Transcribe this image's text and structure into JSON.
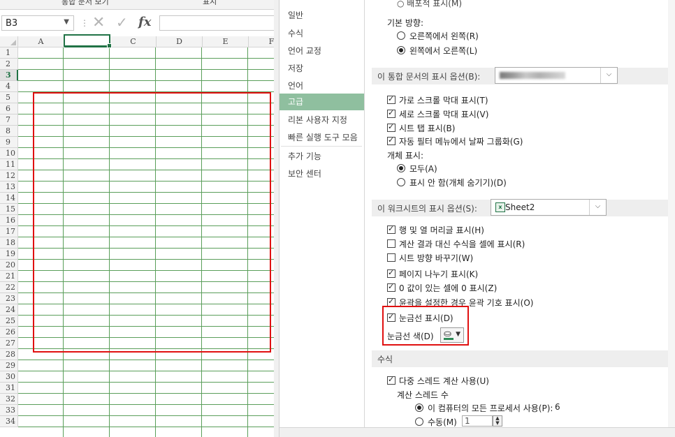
{
  "excel": {
    "ribbon_labels": [
      "통합 문서 보기",
      "표시"
    ],
    "name_box": "B3",
    "col_headers": [
      "A",
      "B",
      "C",
      "D",
      "E",
      "F"
    ],
    "selected_col": "B",
    "row_headers": [
      "1",
      "2",
      "3",
      "4",
      "5",
      "6",
      "7",
      "8",
      "9",
      "10",
      "11",
      "12",
      "13",
      "14",
      "15",
      "16",
      "17",
      "18",
      "19",
      "20",
      "21",
      "22",
      "23",
      "24",
      "25",
      "26",
      "27",
      "28",
      "29",
      "30",
      "31",
      "32",
      "33",
      "34"
    ],
    "selected_row": "3",
    "fx_label": "fx"
  },
  "nav": {
    "items": [
      "일반",
      "수식",
      "언어 교정",
      "저장",
      "언어",
      "고급",
      "리본 사용자 지정",
      "빠른 실행 도구 모음",
      "추가 기능",
      "보안 센터"
    ],
    "active": "고급"
  },
  "content": {
    "top_partial": "○ 배포적 표시(M)",
    "direction_label": "기본 방향:",
    "direction_options": [
      "오른쪽에서 왼쪽(R)",
      "왼쪽에서 오른쪽(L)"
    ],
    "workbook_section": "이 통합 문서의 표시 옵션(B):",
    "workbook_checks": [
      "가로 스크롤 막대 표시(T)",
      "세로 스크롤 막대 표시(V)",
      "시트 탭 표시(B)",
      "자동 필터 메뉴에서 날짜 그룹화(G)"
    ],
    "object_label": "개체 표시:",
    "object_options": [
      "모두(A)",
      "표시 안 함(개체 숨기기)(D)"
    ],
    "sheet_section": "이 워크시트의 표시 옵션(S):",
    "sheet_name": "Sheet2",
    "sheet_icon": "x",
    "sheet_checks": [
      {
        "label": "행 및 열 머리글 표시(H)",
        "checked": true
      },
      {
        "label": "계산 결과 대신 수식을 셀에 표시(R)",
        "checked": false
      },
      {
        "label": "시트 방향 바꾸기(W)",
        "checked": false
      },
      {
        "label": "페이지 나누기 표시(K)",
        "checked": true
      },
      {
        "label": "0 값이 있는 셀에 0 표시(Z)",
        "checked": true
      },
      {
        "label": "윤곽을 설정한 경우 윤곽 기호 표시(O)",
        "checked": true
      },
      {
        "label": "눈금선 표시(D)",
        "checked": true
      }
    ],
    "gridline_color_label": "눈금선 색(D)",
    "gridline_color": "#2e8b57",
    "formula_section": "수식",
    "multithread_label": "다중 스레드 계산 사용(U)",
    "thread_count_label": "계산 스레드 수",
    "all_processors_label": "이 컴퓨터의 모든 프로세서 사용(P):",
    "all_processors_value": "6",
    "manual_label": "수동(M)",
    "manual_value": "1"
  },
  "colors": {
    "excel_green": "#217346",
    "highlight_red": "#e01010",
    "nav_active": "#8fbf9f",
    "gridline": "#5a9e5a"
  }
}
